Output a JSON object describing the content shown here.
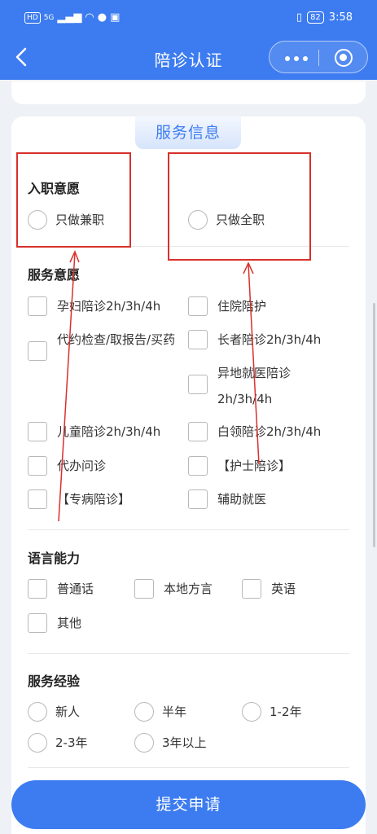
{
  "status_bar": {
    "hd": "HD",
    "net": "5G",
    "battery": "82",
    "time": "3:58"
  },
  "nav": {
    "title": "陪诊认证"
  },
  "section_tag": "服务信息",
  "intent": {
    "heading": "入职意愿",
    "options": [
      "只做兼职",
      "只做全职"
    ]
  },
  "service": {
    "heading": "服务意愿",
    "left": [
      "孕妇陪诊2h/3h/4h",
      "代约检查/取报告/买药",
      "儿童陪诊2h/3h/4h",
      "代办问诊",
      "【专病陪诊】"
    ],
    "right": [
      "住院陪护",
      "长者陪诊2h/3h/4h",
      "异地就医陪诊2h/3h/4h",
      "白领陪诊2h/3h/4h",
      "【护士陪诊】",
      "辅助就医"
    ]
  },
  "language": {
    "heading": "语言能力",
    "options": [
      "普通话",
      "本地方言",
      "英语",
      "其他"
    ]
  },
  "experience": {
    "heading": "服务经验",
    "options": [
      "新人",
      "半年",
      "1-2年",
      "2-3年",
      "3年以上"
    ]
  },
  "submit_label": "提交申请",
  "colors": {
    "primary": "#3d7cf0",
    "annotation": "#d9302c"
  }
}
